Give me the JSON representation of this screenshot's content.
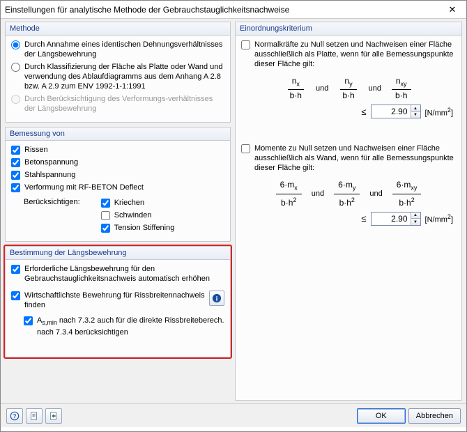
{
  "window": {
    "title": "Einstellungen für analytische Methode der Gebrauchstauglichkeitsnachweise"
  },
  "method": {
    "title": "Methode",
    "opt1": "Durch Annahme eines identischen Dehnungsverhältnisses der Längsbewehrung",
    "opt2": "Durch Klassifizierung der Fläche als Platte oder Wand und verwendung des Ablaufdiagramms aus dem Anhang A 2.8 bzw. A 2.9 zum ENV 1992-1-1:1991",
    "opt3": "Durch Berücksichtigung des Verformungs-verhältnisses der Längsbewehrung"
  },
  "design": {
    "title": "Bemessung von",
    "rissen": "Rissen",
    "betonspannung": "Betonspannung",
    "stahlspannung": "Stahlspannung",
    "verformung": "Verformung mit RF-BETON Deflect",
    "beruecksichtigen": "Berücksichtigen:",
    "kriechen": "Kriechen",
    "schwinden": "Schwinden",
    "tension": "Tension Stiffening"
  },
  "longreinf": {
    "title": "Bestimmung der Längsbewehrung",
    "auto": "Erforderliche Längsbewehrung für den Gebrauchstauglichkeitsnachweis automatisch erhöhen",
    "economic": "Wirtschaftlichste Bewehrung für Rissbreitennachweis finden",
    "asmin_pre": "A",
    "asmin_sub": "s,min",
    "asmin_post": " nach 7.3.2 auch für die direkte Rissbreiteberech. nach 7.3.4 berücksichtigen"
  },
  "criteria": {
    "title": "Einordnungskriterium",
    "plate_text": "Normalkräfte zu Null setzen und Nachweisen einer Fläche ausschließlich als Platte, wenn für alle Bemessungspunkte dieser Fläche gilt:",
    "wall_text": "Momente zu Null setzen und Nachweisen einer Fläche ausschließlich als Wand, wenn für alle Bemessungspunkte dieser Fläche gilt:",
    "und": "und",
    "plate_value": "2.90",
    "wall_value": "2.90"
  },
  "units": {
    "stress": "[N/mm²]"
  },
  "buttons": {
    "ok": "OK",
    "cancel": "Abbrechen"
  }
}
